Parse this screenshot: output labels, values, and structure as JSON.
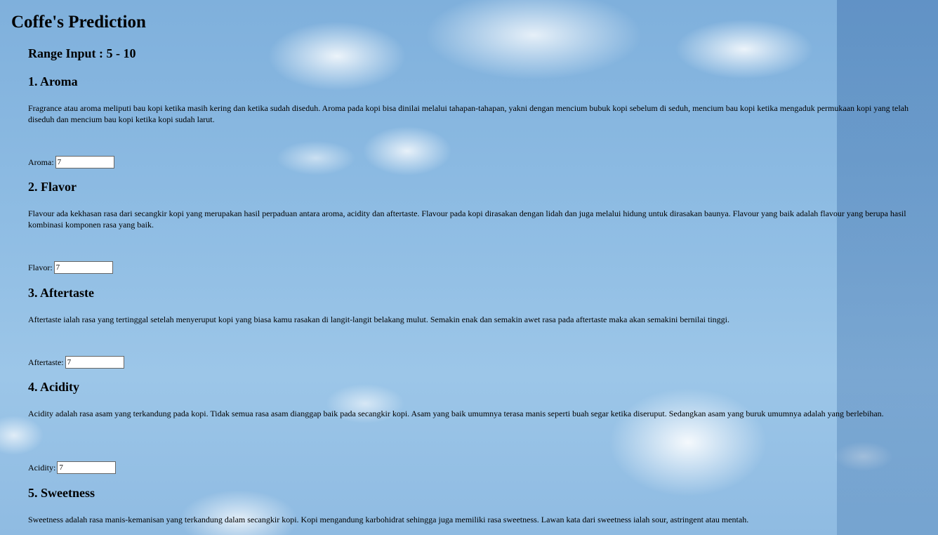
{
  "page": {
    "title": "Coffe's Prediction",
    "range_input": "Range Input : 5 - 10"
  },
  "sections": [
    {
      "heading": "1. Aroma",
      "description": "Fragrance atau aroma meliputi bau kopi ketika masih kering dan ketika sudah diseduh. Aroma pada kopi bisa dinilai melalui tahapan-tahapan, yakni dengan mencium bubuk kopi sebelum di seduh, mencium bau kopi ketika mengaduk permukaan kopi yang telah diseduh dan mencium bau kopi ketika kopi sudah larut.",
      "field_label": "Aroma:",
      "value": "7"
    },
    {
      "heading": "2. Flavor",
      "description": "Flavour ada kekhasan rasa dari secangkir kopi yang merupakan hasil perpaduan antara aroma, acidity dan aftertaste. Flavour pada kopi dirasakan dengan lidah dan juga melalui hidung untuk dirasakan baunya. Flavour yang baik adalah flavour yang berupa hasil kombinasi komponen rasa yang baik.",
      "field_label": "Flavor:",
      "value": "7"
    },
    {
      "heading": "3. Aftertaste",
      "description": "Aftertaste ialah rasa yang tertinggal setelah menyeruput kopi yang biasa kamu rasakan di langit-langit belakang mulut. Semakin enak dan semakin awet rasa pada aftertaste maka akan semakini bernilai tinggi.",
      "field_label": "Aftertaste:",
      "value": "7"
    },
    {
      "heading": "4. Acidity",
      "description": "Acidity adalah rasa asam yang terkandung pada kopi. Tidak semua rasa asam dianggap baik pada secangkir kopi. Asam yang baik umumnya terasa manis seperti buah segar ketika diseruput. Sedangkan asam yang buruk umumnya adalah yang berlebihan.",
      "field_label": "Acidity:",
      "value": "7"
    },
    {
      "heading": "5. Sweetness",
      "description": "Sweetness adalah rasa manis-kemanisan yang terkandung dalam secangkir kopi. Kopi mengandung karbohidrat sehingga juga memiliki rasa sweetness. Lawan kata dari sweetness ialah sour, astringent atau mentah."
    }
  ]
}
